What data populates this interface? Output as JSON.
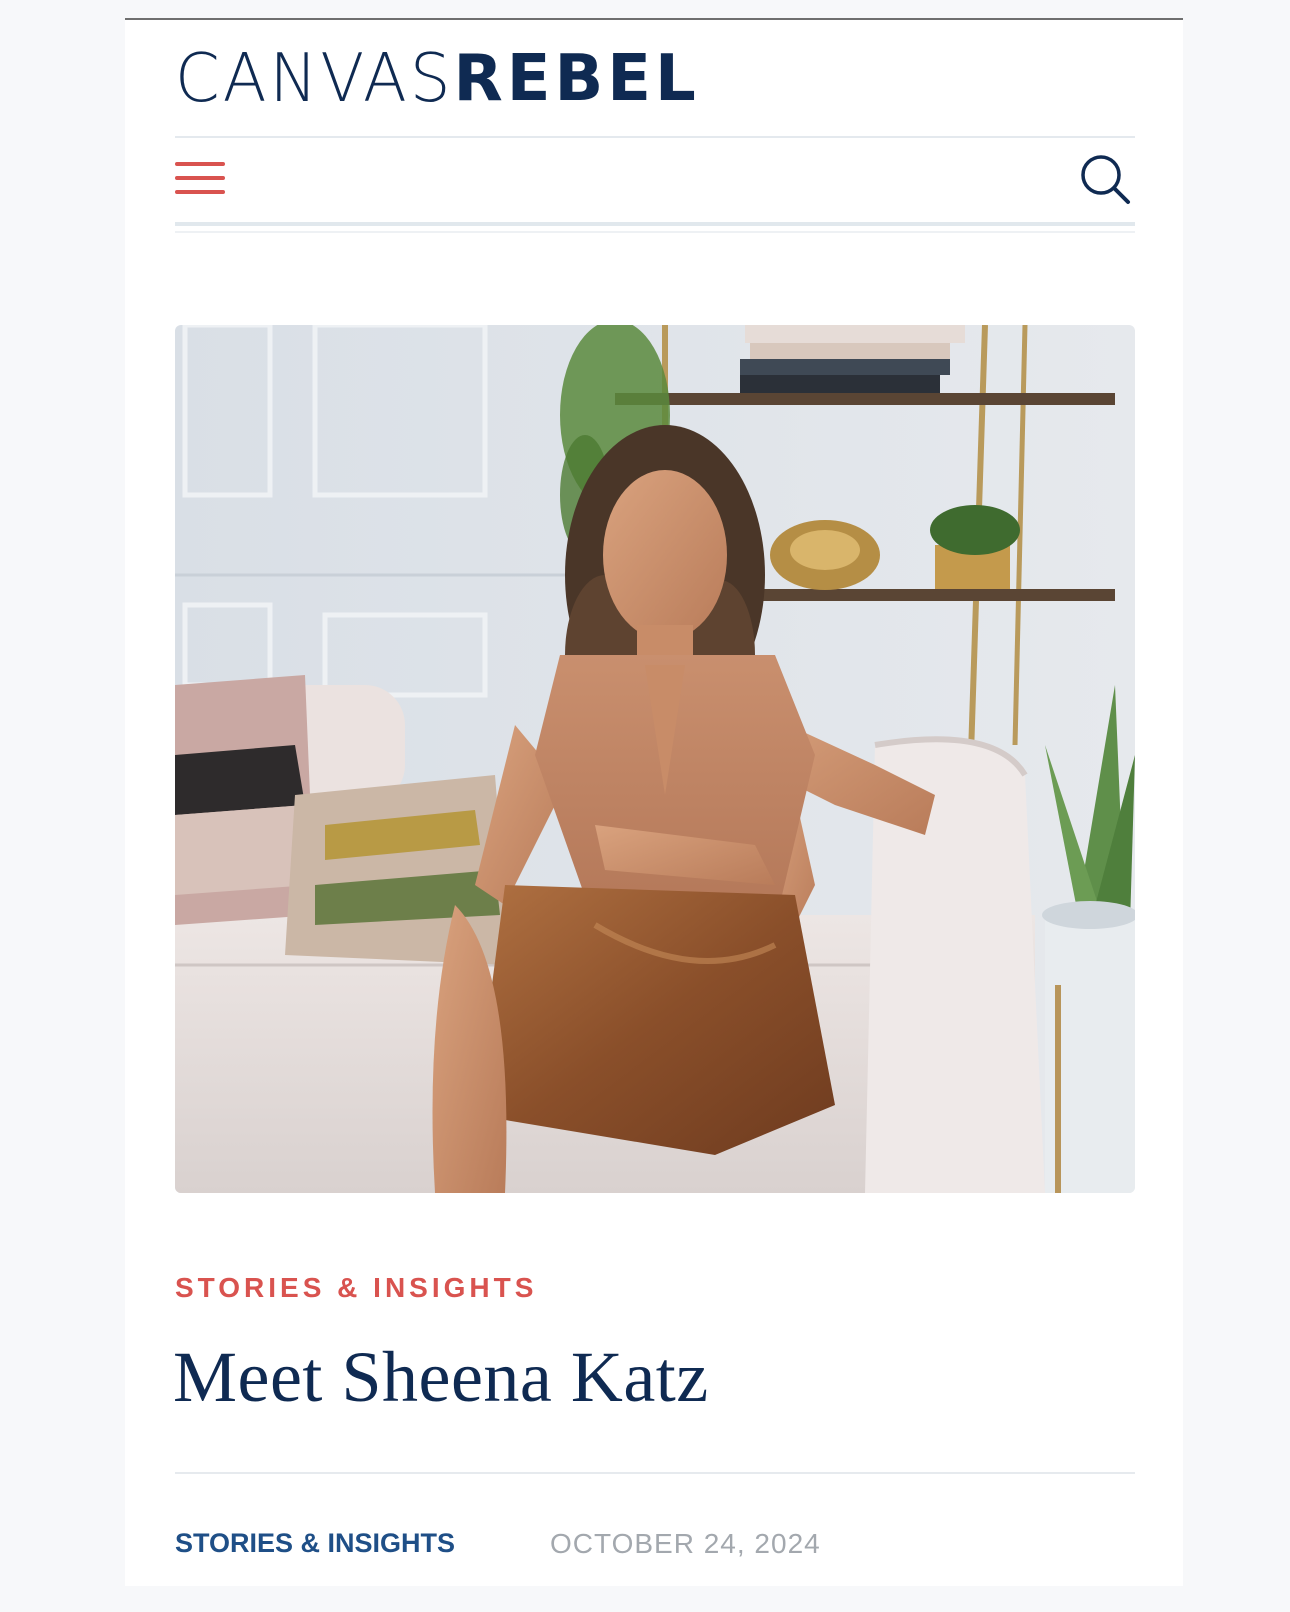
{
  "brand": {
    "logo_part_thin": "CANVAS",
    "logo_part_bold": "REBEL",
    "primary_color": "#0f2a52",
    "accent_color": "#d9534f"
  },
  "nav": {
    "menu_icon": "hamburger-menu-icon",
    "search_icon": "search-icon"
  },
  "hero": {
    "image_description_icon": "portrait-photo"
  },
  "article": {
    "kicker": "STORIES & INSIGHTS",
    "title": "Meet Sheena Katz",
    "category": "STORIES & INSIGHTS",
    "date": "OCTOBER 24, 2024"
  }
}
